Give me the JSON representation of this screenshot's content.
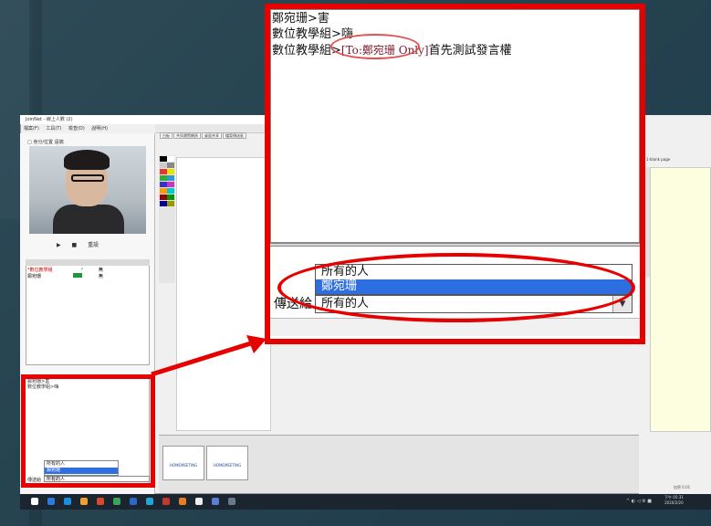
{
  "app": {
    "window_title": "JoinNet - 線上人數 (2)",
    "menu": [
      "檔案(F)",
      "工具(T)",
      "檢查(D)",
      "說明(H)"
    ],
    "window_controls": [
      "–",
      "☐",
      "✕"
    ]
  },
  "camera": {
    "label": "□ 身分/位置 遠端"
  },
  "camera_buttons": [
    "▶",
    "■",
    "重設"
  ],
  "user_list": {
    "users": [
      {
        "name": "*數位教學組",
        "status": "✓",
        "value": "無"
      },
      {
        "name": "鄭宛珊",
        "status": "✓",
        "value": "無"
      }
    ]
  },
  "small_chat": {
    "messages": [
      "鄭宛珊>害",
      "數位教學組>嗨"
    ],
    "dropdown_options": [
      "所有的人",
      "鄭宛珊"
    ],
    "send_to_label": "傳送給",
    "send_to_value": "所有的人"
  },
  "whiteboard": {
    "tabs": [
      "白板",
      "共同瀏覽網頁",
      "桌面共享",
      "檔案傳送區"
    ],
    "page_label": "1-blank page",
    "thumbnail_label": "HOMEMEETING"
  },
  "zoomed_chat": {
    "line1": "鄭宛珊>害",
    "line2": "數位教學組>嗨",
    "line3_prefix": "數位教學組>",
    "line3_private": "[To:鄭宛珊 Only]",
    "line3_text": "首先測試發言權",
    "dropdown_options": [
      "所有的人",
      "鄭宛珊"
    ],
    "send_to_label": "傳送給",
    "send_to_value": "所有的人",
    "dropdown_arrow": "▼"
  },
  "taskbar": {
    "clock_time": "下午 05:31",
    "clock_date": "2020/2/20",
    "version": "加密 0.01"
  },
  "colors": {
    "annotation_red": "#e60000",
    "selection_blue": "#2d6ee0",
    "slide_background": "#264350"
  }
}
